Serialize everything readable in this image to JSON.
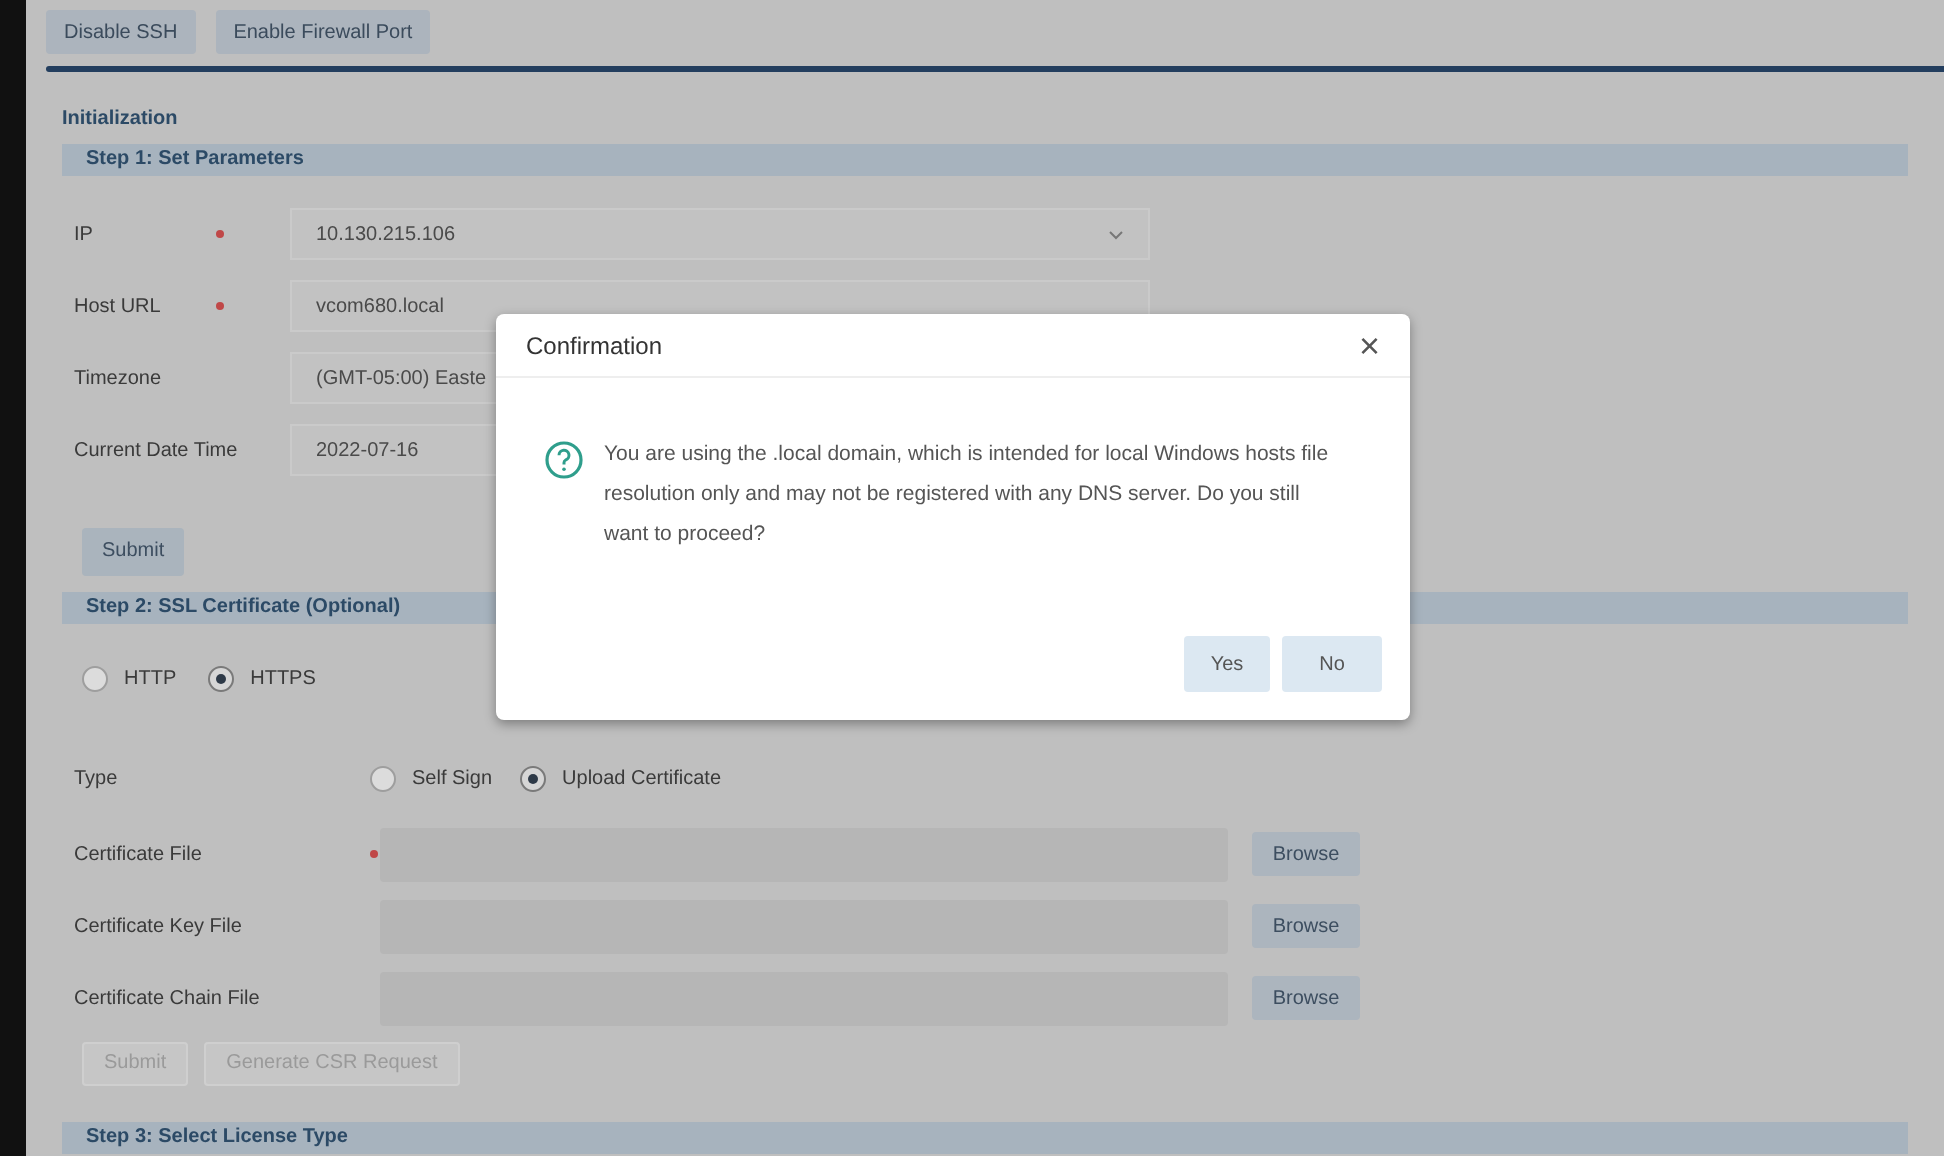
{
  "toolbar": {
    "buttons": [
      "Disable SSH",
      "Enable Firewall Port"
    ]
  },
  "section_title": "Initialization",
  "step1": {
    "title": "Step 1: Set Parameters",
    "fields": [
      {
        "label": "IP",
        "required": true,
        "value": "10.130.215.106",
        "kind": "select"
      },
      {
        "label": "Host URL",
        "required": true,
        "value": "vcom680.local",
        "kind": "text"
      },
      {
        "label": "Timezone",
        "required": false,
        "value": "(GMT-05:00) Easte",
        "kind": "text"
      },
      {
        "label": "Current Date Time",
        "required": false,
        "value": "2022-07-16",
        "kind": "text"
      }
    ],
    "submit": {
      "label": "Submit",
      "disabled": false
    }
  },
  "step2": {
    "title": "Step 2: SSL Certificate (Optional)",
    "protocol": [
      {
        "label": "HTTP",
        "selected": false
      },
      {
        "label": "HTTPS",
        "selected": true
      }
    ],
    "type": {
      "label": "Type",
      "options": [
        {
          "label": "Self Sign",
          "selected": false
        },
        {
          "label": "Upload Certificate",
          "selected": true
        }
      ]
    },
    "files": [
      {
        "label": "Certificate File",
        "required": true,
        "button": "Browse"
      },
      {
        "label": "Certificate Key File",
        "required": false,
        "button": "Browse"
      },
      {
        "label": "Certificate Chain File",
        "required": false,
        "button": "Browse"
      }
    ],
    "actions": [
      {
        "label": "Submit",
        "disabled": true
      },
      {
        "label": "Generate CSR Request",
        "disabled": true
      }
    ]
  },
  "step3": {
    "title": "Step 3: Select License Type"
  },
  "dialog": {
    "title": "Confirmation",
    "close": "×",
    "message": "You are using the .local domain, which is intended for local Windows hosts file resolution only and may not be registered with any DNS server. Do you still want to proceed?",
    "buttons": [
      "Yes",
      "No"
    ]
  }
}
